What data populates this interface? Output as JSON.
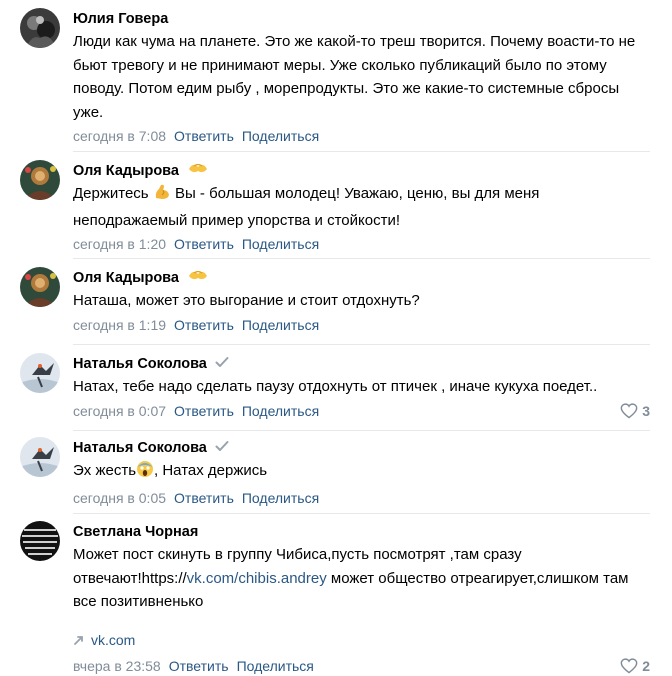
{
  "colors": {
    "link": "#2a5885",
    "meta": "#818c99",
    "separator": "#e7e8ec"
  },
  "actions": {
    "reply": "Ответить",
    "share": "Поделиться"
  },
  "comments": [
    {
      "author": "Юлия Говера",
      "text": "Люди как чума на планете. Это же какой-то треш творится. Почему воасти-то не бьют тревогу и не принимают меры. Уже сколько публикаций было по этому поводу. Потом едим рыбу , морепродукты. Это же какие-то системные сбросы уже.",
      "date": "сегодня в 7:08"
    },
    {
      "author": "Оля Кадырова",
      "badge_icon": "heart-hands-emoji",
      "text_before": "Держитесь",
      "text_after": "Вы - большая молодец! Уважаю, ценю, вы для меня неподражаемый пример упорства и стойкости!",
      "date": "сегодня в 1:20"
    },
    {
      "author": "Оля Кадырова",
      "badge_icon": "heart-hands-emoji",
      "text": "Наташа, может это выгорание и стоит отдохнуть?",
      "date": "сегодня в 1:19"
    },
    {
      "author": "Наталья Соколова",
      "badge_icon": "check-icon",
      "text": "Натах, тебе надо сделать паузу отдохнуть от птичек , иначе кукуха поедет..",
      "date": "сегодня в 0:07",
      "likes": "3"
    },
    {
      "author": "Наталья Соколова",
      "badge_icon": "check-icon",
      "text_before": "Эх жесть",
      "text_after": ", Натах держись",
      "date": "сегодня в 0:05"
    },
    {
      "author": "Светлана Чорная",
      "text_before": "Может пост скинуть в группу Чибиса,пусть посмотрят ,там сразу отвечают!https://",
      "link": "vk.com/chibis.andrey",
      "text_after": " может общество отреагирует,слишком там все позитивненько",
      "attachment_link": "vk.com",
      "date": "вчера в 23:58",
      "likes": "2"
    }
  ]
}
